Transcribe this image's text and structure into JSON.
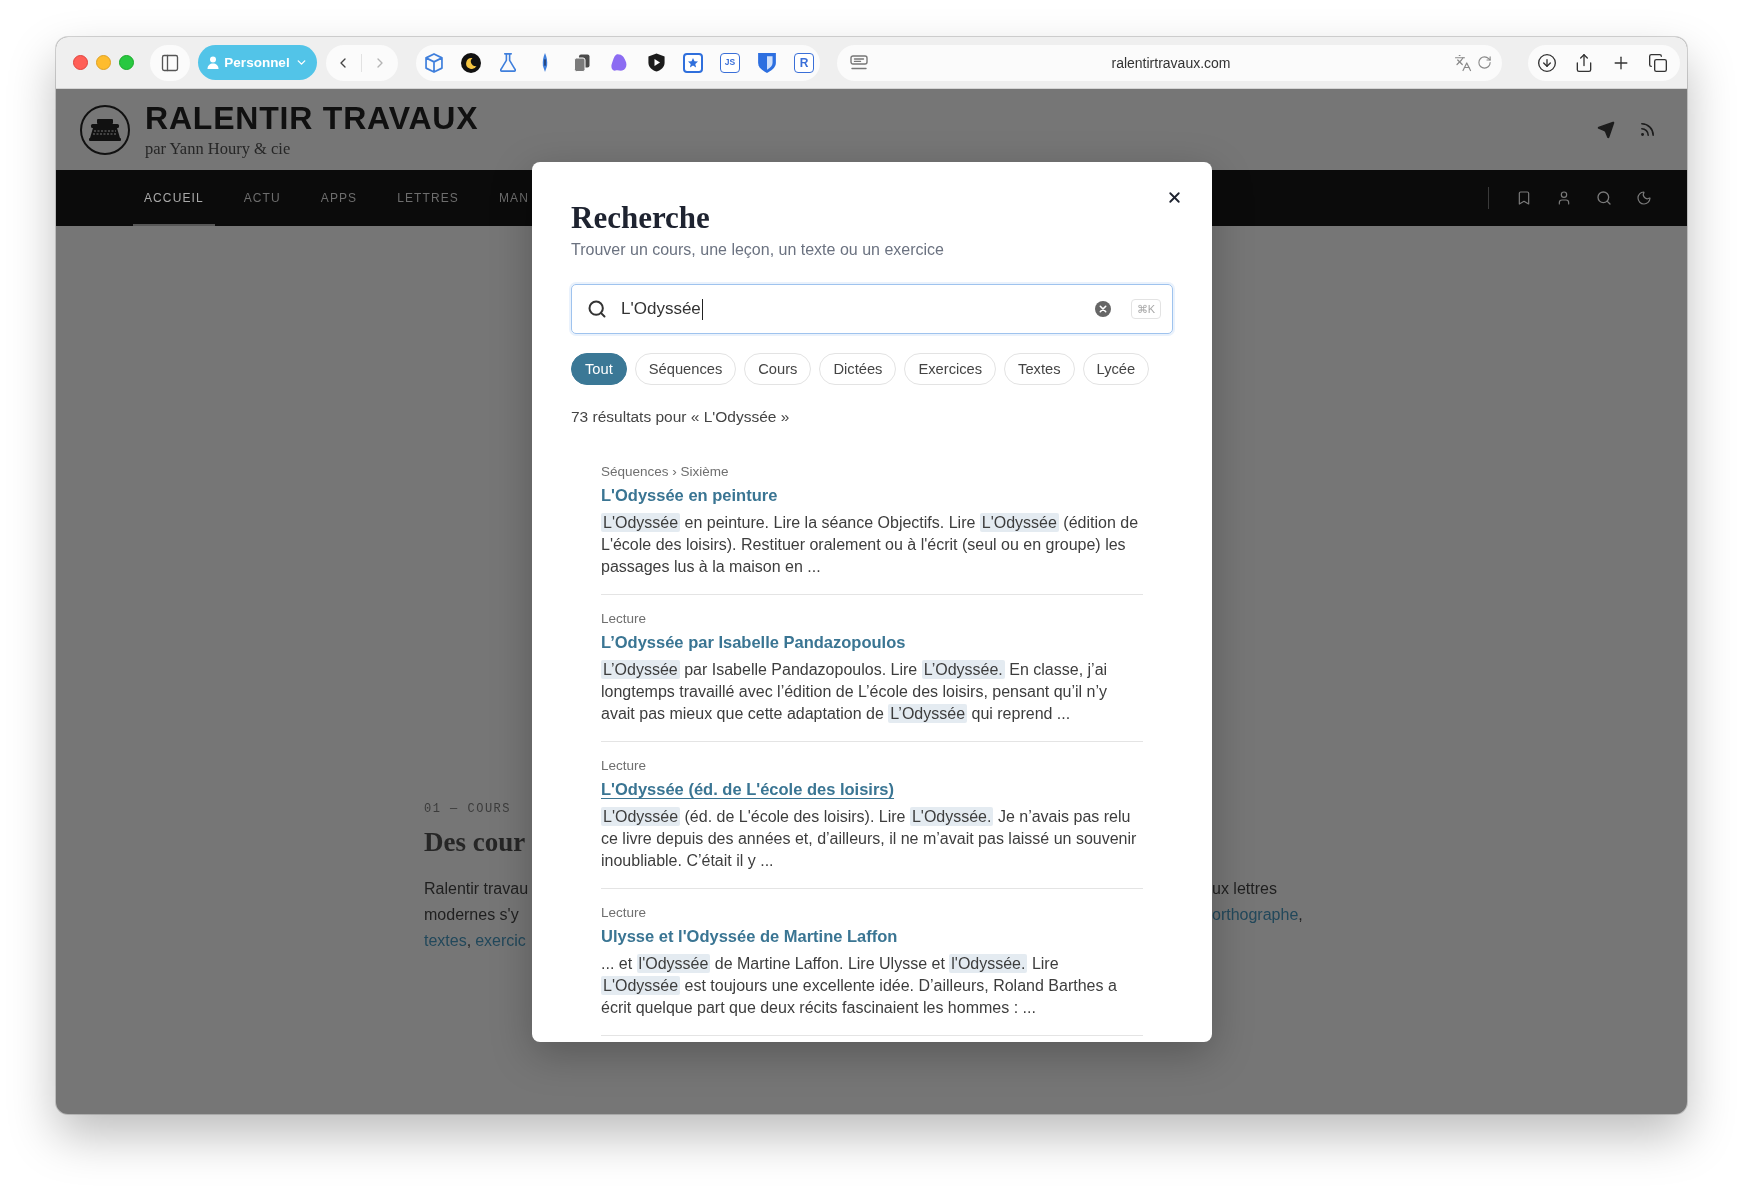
{
  "browser": {
    "profile": "Personnel",
    "extensions": [
      {
        "kind": "cube"
      },
      {
        "kind": "moon"
      },
      {
        "kind": "flask"
      },
      {
        "kind": "pen"
      },
      {
        "kind": "copy"
      },
      {
        "kind": "blob"
      },
      {
        "kind": "play-shield"
      },
      {
        "kind": "star-square"
      },
      {
        "kind": "letters",
        "label": "JS"
      },
      {
        "kind": "shield"
      },
      {
        "kind": "letters",
        "label": "R"
      }
    ],
    "url": "ralentirtravaux.com"
  },
  "site": {
    "title": "RALENTIR TRAVAUX",
    "tagline": "par Yann Houry & cie",
    "nav": [
      {
        "label": "ACCUEIL",
        "selected": true
      },
      {
        "label": "ACTU",
        "selected": false
      },
      {
        "label": "APPS",
        "selected": false
      },
      {
        "label": "LETTRES",
        "selected": false
      },
      {
        "label": "MAN",
        "selected": false
      }
    ]
  },
  "article": {
    "eyebrow": "01 — COURS",
    "heading": "Des cour",
    "left_lines": [
      [
        {
          "kind": "text",
          "text": "Ralentir travau"
        }
      ],
      [
        {
          "kind": "text",
          "text": "modernes s'y"
        }
      ],
      [
        {
          "kind": "link",
          "text": "textes"
        },
        {
          "kind": "text",
          "text": ","
        },
        {
          "kind": "link",
          "text": "exercic"
        }
      ]
    ],
    "right_lines": [
      [
        {
          "kind": "text",
          "text": "ux lettres"
        }
      ],
      [
        {
          "kind": "link",
          "text": "orthographe"
        },
        {
          "kind": "text",
          "text": ","
        }
      ]
    ]
  },
  "search_dialog": {
    "title": "Recherche",
    "subtitle": "Trouver un cours, une leçon, un texte ou un exercice",
    "query": "L'Odyssée",
    "shortcut": "⌘K",
    "filters": [
      {
        "label": "Tout",
        "selected": true
      },
      {
        "label": "Séquences",
        "selected": false
      },
      {
        "label": "Cours",
        "selected": false
      },
      {
        "label": "Dictées",
        "selected": false
      },
      {
        "label": "Exercices",
        "selected": false
      },
      {
        "label": "Textes",
        "selected": false
      },
      {
        "label": "Lycée",
        "selected": false
      }
    ],
    "result_count": "73 résultats pour « L'Odyssée »",
    "results": [
      {
        "category": "Séquences › Sixième",
        "title": "L'Odyssée en peinture",
        "hovered": false,
        "snippet": [
          [
            {
              "text": "L'Odyssée",
              "highlight": true
            },
            {
              "text": " en peinture. Lire la séance Objectifs. Lire ",
              "highlight": false
            },
            {
              "text": "L'Odyssée",
              "highlight": true
            },
            {
              "text": " (édition de",
              "highlight": false
            }
          ],
          [
            {
              "text": "L'école des loisirs). Restituer oralement ou à l'écrit (seul ou en groupe) les",
              "highlight": false
            }
          ],
          [
            {
              "text": "passages lus à la maison en ...",
              "highlight": false
            }
          ]
        ]
      },
      {
        "category": "Lecture",
        "title": "L’Odyssée par Isabelle Pandazopoulos",
        "hovered": false,
        "snippet": [
          [
            {
              "text": "L’Odyssée",
              "highlight": true
            },
            {
              "text": " par Isabelle Pandazopoulos. Lire ",
              "highlight": false
            },
            {
              "text": "L’Odyssée.",
              "highlight": true
            },
            {
              "text": " En classe, j’ai",
              "highlight": false
            }
          ],
          [
            {
              "text": "longtemps travaillé avec l’édition de L’école des loisirs, pensant qu’il n’y",
              "highlight": false
            }
          ],
          [
            {
              "text": "avait pas mieux que cette adaptation de ",
              "highlight": false
            },
            {
              "text": "L’Odyssée",
              "highlight": true
            },
            {
              "text": " qui reprend ...",
              "highlight": false
            }
          ]
        ]
      },
      {
        "category": "Lecture",
        "title": "L'Odyssée (éd. de L'école des loisirs)",
        "hovered": true,
        "snippet": [
          [
            {
              "text": "L'Odyssée",
              "highlight": true
            },
            {
              "text": " (éd. de L'école des loisirs). Lire ",
              "highlight": false
            },
            {
              "text": "L'Odyssée.",
              "highlight": true
            },
            {
              "text": " Je n’avais pas relu",
              "highlight": false
            }
          ],
          [
            {
              "text": "ce livre depuis des années et, d’ailleurs, il ne m’avait pas laissé un souvenir",
              "highlight": false
            }
          ],
          [
            {
              "text": "inoubliable. C’était il y ...",
              "highlight": false
            }
          ]
        ]
      },
      {
        "category": "Lecture",
        "title": "Ulysse et l'Odyssée de Martine Laffon",
        "hovered": false,
        "snippet": [
          [
            {
              "text": "... et ",
              "highlight": false
            },
            {
              "text": "l'Odyssée",
              "highlight": true
            },
            {
              "text": " de Martine Laffon. Lire Ulysse et ",
              "highlight": false
            },
            {
              "text": "l'Odyssée.",
              "highlight": true
            },
            {
              "text": " Lire",
              "highlight": false
            }
          ],
          [
            {
              "text": "L'Odyssée",
              "highlight": true
            },
            {
              "text": " est toujours une excellente idée. D’ailleurs, Roland Barthes a",
              "highlight": false
            }
          ],
          [
            {
              "text": "écrit quelque part que deux récits fascinaient les hommes : ...",
              "highlight": false
            }
          ]
        ]
      }
    ]
  }
}
